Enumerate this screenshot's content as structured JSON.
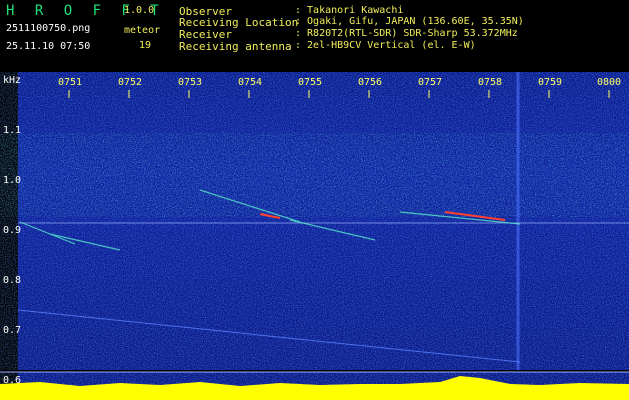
{
  "app": {
    "logo_text": "H R O F F T",
    "version": "1.0.0",
    "filename": "2511100750.png",
    "datetime": "25.11.10 07:50",
    "mode_label": "meteor",
    "meteor_count": "19"
  },
  "station": {
    "rows": [
      {
        "label": "Observer",
        "value": ": Takanori Kawachi"
      },
      {
        "label": "Receiving Location",
        "value": ": Ogaki, Gifu, JAPAN (136.60E, 35.35N)"
      },
      {
        "label": "Receiver",
        "value": ": R820T2(RTL-SDR) SDR-Sharp 53.372MHz"
      },
      {
        "label": "Receiving antenna",
        "value": ": 2el-HB9CV Vertical (el. E-W)"
      }
    ]
  },
  "spectrogram": {
    "y_unit": "kHz",
    "y_ticks": [
      "1.1",
      "1.0",
      "0.9",
      "0.8",
      "0.7",
      "0.6"
    ],
    "time_ticks": [
      "0751",
      "0752",
      "0753",
      "0754",
      "0755",
      "0756",
      "0757",
      "0758",
      "0759",
      "0800"
    ],
    "colors": {
      "background": "#0a1a8a",
      "noise": "#1c3cd0",
      "band": "#20c8a0",
      "trace": "#ff4030",
      "level": "#ffff00"
    }
  }
}
